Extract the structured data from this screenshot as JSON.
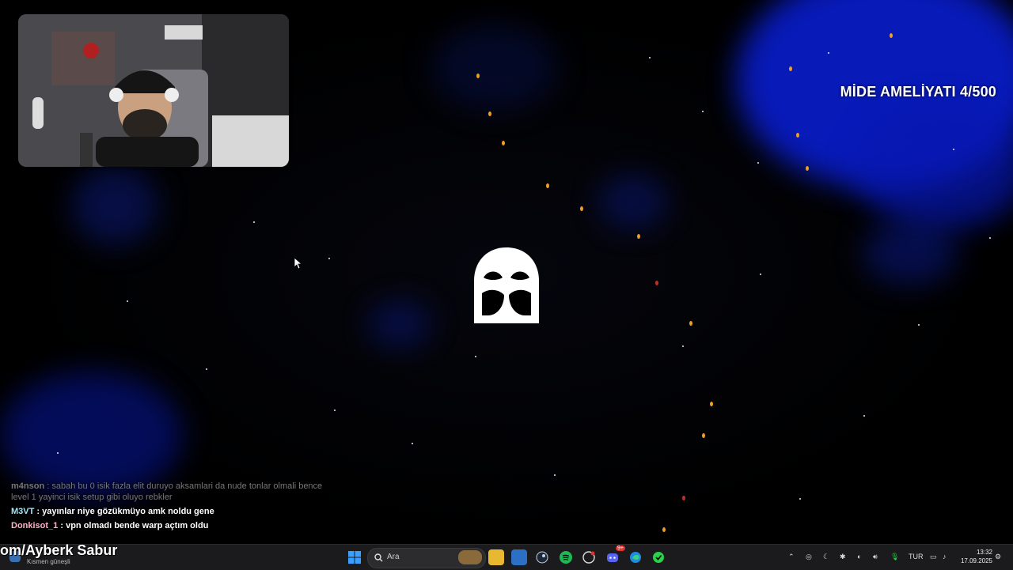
{
  "overlay": {
    "title": "MİDE AMELİYATI 4/500"
  },
  "chat": {
    "messages": [
      {
        "user": "m4nson",
        "text": ": sabah bu 0 isik fazla elit duruyo aksamlari da nude tonlar olmali bence level 1 yayinci isik setup gibi oluyo rebkler",
        "user_color": "#777777",
        "faded": true
      },
      {
        "user": "M3VT",
        "text": ": yayınlar niye gözükmüyo amk noldu gene",
        "user_color": "#9be7ff",
        "faded": false
      },
      {
        "user": "Donkisot_1",
        "text": ": vpn olmadı bende warp açtım oldu",
        "user_color": "#ffb3c8",
        "faded": false
      }
    ]
  },
  "social": {
    "handle": "om/Ayberk Sabur"
  },
  "taskbar": {
    "weather_text": "Kısmen güneşli",
    "search_placeholder": "Ara",
    "language": "TUR",
    "time": "13:32",
    "date": "17.09.2025",
    "discord_badge": "9+"
  },
  "colors": {
    "accent_blue": "#0a1fd8",
    "ember": "#f0a020",
    "taskbar_bg": "#1b1b1d"
  },
  "icons": {
    "app_logo": "mask-logo-icon",
    "windows": "windows-start-icon",
    "search": "search-icon",
    "explorer": "folder-icon",
    "store": "store-icon",
    "steam": "steam-icon",
    "spotify": "spotify-icon",
    "obs": "obs-icon",
    "discord": "discord-icon",
    "edge": "edge-icon",
    "bluestacks": "app-icon"
  }
}
